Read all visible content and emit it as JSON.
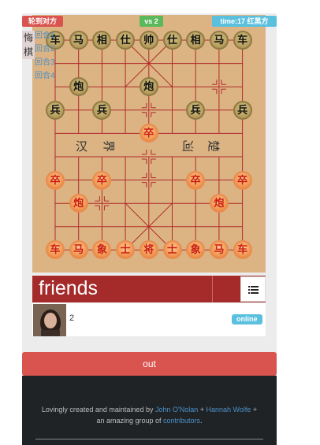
{
  "status": {
    "turn_label": "轮到对方",
    "vs_label": "vs 2",
    "time_label": "time:17 红黑方"
  },
  "controls": {
    "undo_label": "悔棋"
  },
  "moves": [
    "回合1",
    "回合2",
    "回合3",
    "回合4"
  ],
  "river": {
    "left_chars": [
      "汉",
      "界"
    ],
    "right_chars": [
      "河",
      "楚"
    ]
  },
  "pieces": [
    {
      "side": "black",
      "char": "车",
      "col": 0,
      "row": 0
    },
    {
      "side": "black",
      "char": "马",
      "col": 1,
      "row": 0
    },
    {
      "side": "black",
      "char": "相",
      "col": 2,
      "row": 0
    },
    {
      "side": "black",
      "char": "仕",
      "col": 3,
      "row": 0
    },
    {
      "side": "black",
      "char": "帅",
      "col": 4,
      "row": 0
    },
    {
      "side": "black",
      "char": "仕",
      "col": 5,
      "row": 0
    },
    {
      "side": "black",
      "char": "相",
      "col": 6,
      "row": 0
    },
    {
      "side": "black",
      "char": "马",
      "col": 7,
      "row": 0
    },
    {
      "side": "black",
      "char": "车",
      "col": 8,
      "row": 0
    },
    {
      "side": "black",
      "char": "炮",
      "col": 1,
      "row": 2
    },
    {
      "side": "black",
      "char": "炮",
      "col": 4,
      "row": 2
    },
    {
      "side": "black",
      "char": "兵",
      "col": 0,
      "row": 3
    },
    {
      "side": "black",
      "char": "兵",
      "col": 2,
      "row": 3
    },
    {
      "side": "black",
      "char": "兵",
      "col": 6,
      "row": 3
    },
    {
      "side": "black",
      "char": "兵",
      "col": 8,
      "row": 3
    },
    {
      "side": "red",
      "char": "卒",
      "col": 4,
      "row": 4
    },
    {
      "side": "red",
      "char": "卒",
      "col": 0,
      "row": 6
    },
    {
      "side": "red",
      "char": "卒",
      "col": 2,
      "row": 6
    },
    {
      "side": "red",
      "char": "卒",
      "col": 6,
      "row": 6
    },
    {
      "side": "red",
      "char": "卒",
      "col": 8,
      "row": 6
    },
    {
      "side": "red",
      "char": "炮",
      "col": 1,
      "row": 7
    },
    {
      "side": "red",
      "char": "炮",
      "col": 7,
      "row": 7
    },
    {
      "side": "red",
      "char": "车",
      "col": 0,
      "row": 9
    },
    {
      "side": "red",
      "char": "马",
      "col": 1,
      "row": 9
    },
    {
      "side": "red",
      "char": "象",
      "col": 2,
      "row": 9
    },
    {
      "side": "red",
      "char": "士",
      "col": 3,
      "row": 9
    },
    {
      "side": "red",
      "char": "将",
      "col": 4,
      "row": 9
    },
    {
      "side": "red",
      "char": "士",
      "col": 5,
      "row": 9
    },
    {
      "side": "red",
      "char": "象",
      "col": 6,
      "row": 9
    },
    {
      "side": "red",
      "char": "马",
      "col": 7,
      "row": 9
    },
    {
      "side": "red",
      "char": "车",
      "col": 8,
      "row": 9
    }
  ],
  "friends": {
    "title": "friends",
    "list_icon": "list-icon",
    "items": [
      {
        "name": "2",
        "status": "online"
      }
    ]
  },
  "actions": {
    "out_label": "out"
  },
  "footer": {
    "prefix": "Lovingly created and maintained by ",
    "author1": "John O'Nolan",
    "plus1": " + ",
    "author2": "Hannah Wolfe",
    "middle": " + an amazing group of ",
    "contributors": "contributors",
    "suffix": "."
  },
  "colors": {
    "board": "#dcb483",
    "line": "#b02a2a",
    "red_piece": "#f09048",
    "black_piece": "#b49a5a",
    "friends_bar": "#a52a2a",
    "badge": "#5bc0de",
    "out_button": "#d9534f",
    "footer": "#1f2326"
  }
}
